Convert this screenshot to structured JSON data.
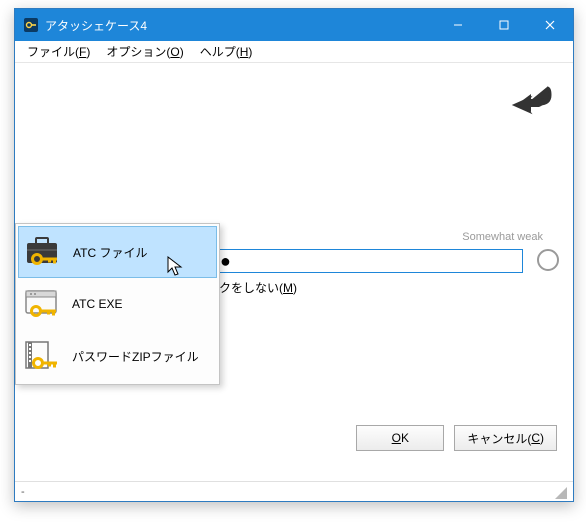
{
  "window": {
    "title": "アタッシェケース4",
    "minimize": "—",
    "maximize": "☐",
    "close": "✕"
  },
  "menubar": {
    "file": "ファイル(",
    "file_u": "F",
    "file_end": ")",
    "option": "オプション(",
    "option_u": "O",
    "option_end": ")",
    "help": "ヘルプ(",
    "help_u": "H",
    "help_end": ")"
  },
  "strength_label": "Somewhat weak",
  "mask_label_pre": "クをしない(",
  "mask_label_u": "M",
  "mask_label_end": ")",
  "password_mask": "●",
  "popup": {
    "items": [
      {
        "label": "ATC ファイル"
      },
      {
        "label": "ATC EXE"
      },
      {
        "label": "パスワードZIPファイル"
      }
    ]
  },
  "buttons": {
    "ok_u": "O",
    "ok_rest": "K",
    "cancel_pre": "キャンセル(",
    "cancel_u": "C",
    "cancel_end": ")"
  },
  "status": "-"
}
